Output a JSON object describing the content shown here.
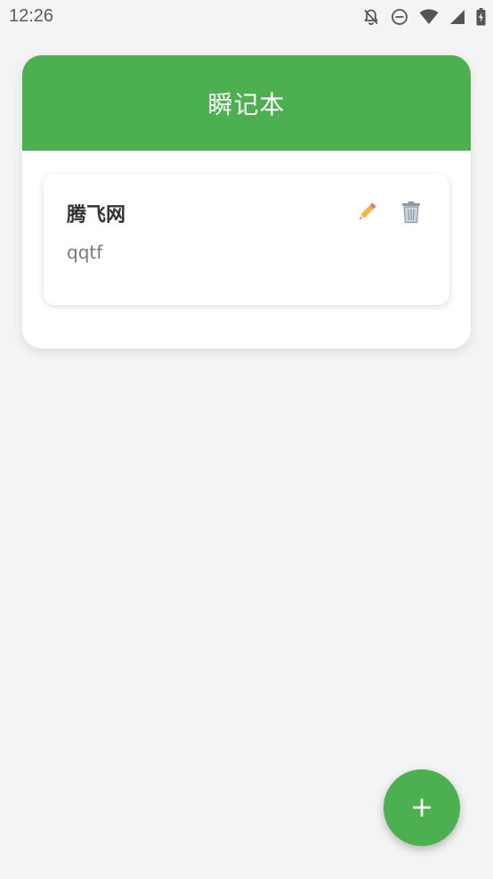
{
  "status_bar": {
    "time": "12:26",
    "icons": [
      "bell-off-icon",
      "do-not-disturb-icon",
      "wifi-icon",
      "signal-icon",
      "battery-charging-icon"
    ]
  },
  "app": {
    "title": "瞬记本"
  },
  "notes": [
    {
      "title": "腾飞网",
      "content": "qqtf",
      "edit_icon": "pencil-icon",
      "delete_icon": "trash-icon"
    }
  ],
  "fab": {
    "label": "+",
    "icon": "plus-icon"
  },
  "colors": {
    "accent": "#4caf50",
    "background": "#f4f4f4",
    "card": "#ffffff",
    "title_text": "#333333",
    "body_text": "#777777"
  }
}
